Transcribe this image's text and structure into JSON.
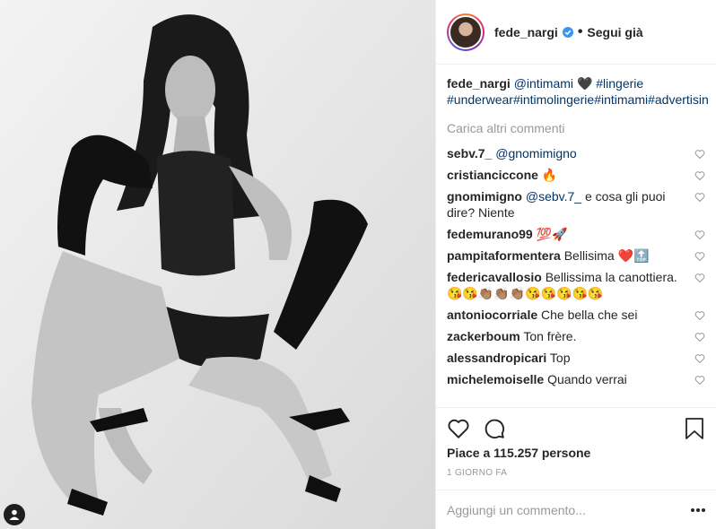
{
  "post": {
    "username": "fede_nargi",
    "follow_status": "Segui già",
    "caption": {
      "user": "fede_nargi",
      "mention": "@intimami",
      "emoji": "🖤",
      "hashtags": "#lingerie #underwear#intimolingerie#intimami#advertising"
    },
    "load_more": "Carica altri commenti",
    "comments": [
      {
        "user": "sebv.7_",
        "text": "",
        "mention": "@gnomimigno"
      },
      {
        "user": "cristianciccone",
        "text": "🔥",
        "mention": ""
      },
      {
        "user": "gnomimigno",
        "text": " e cosa gli puoi dire? Niente",
        "mention": "@sebv.7_"
      },
      {
        "user": "fedemurano99",
        "text": "💯🚀",
        "mention": ""
      },
      {
        "user": "pampitaformentera",
        "text": "Bellisima ❤️🔝",
        "mention": ""
      },
      {
        "user": "federicavallosio",
        "text": "Bellissima la canottiera. 😘😘👏🏽👏🏽👏🏽😘😘😘😘😘",
        "mention": ""
      },
      {
        "user": "antoniocorriale",
        "text": "Che bella che sei",
        "mention": ""
      },
      {
        "user": "zackerboum",
        "text": "Ton frère.",
        "mention": ""
      },
      {
        "user": "alessandropicari",
        "text": "Top",
        "mention": ""
      },
      {
        "user": "michelemoiselle",
        "text": "Quando verrai",
        "mention": ""
      }
    ],
    "likes": "Piace a 115.257 persone",
    "date": "1 GIORNO FA",
    "comment_placeholder": "Aggiungi un commento..."
  },
  "icons": {
    "verified": "verified-badge-icon",
    "heart": "heart-icon",
    "comment": "comment-bubble-icon",
    "bookmark": "bookmark-icon",
    "more": "more-options-icon",
    "user_tag": "user-tag-icon"
  },
  "colors": {
    "text": "#262626",
    "muted": "#999999",
    "link": "#003569",
    "verified": "#3897f0",
    "border": "#efefef"
  }
}
